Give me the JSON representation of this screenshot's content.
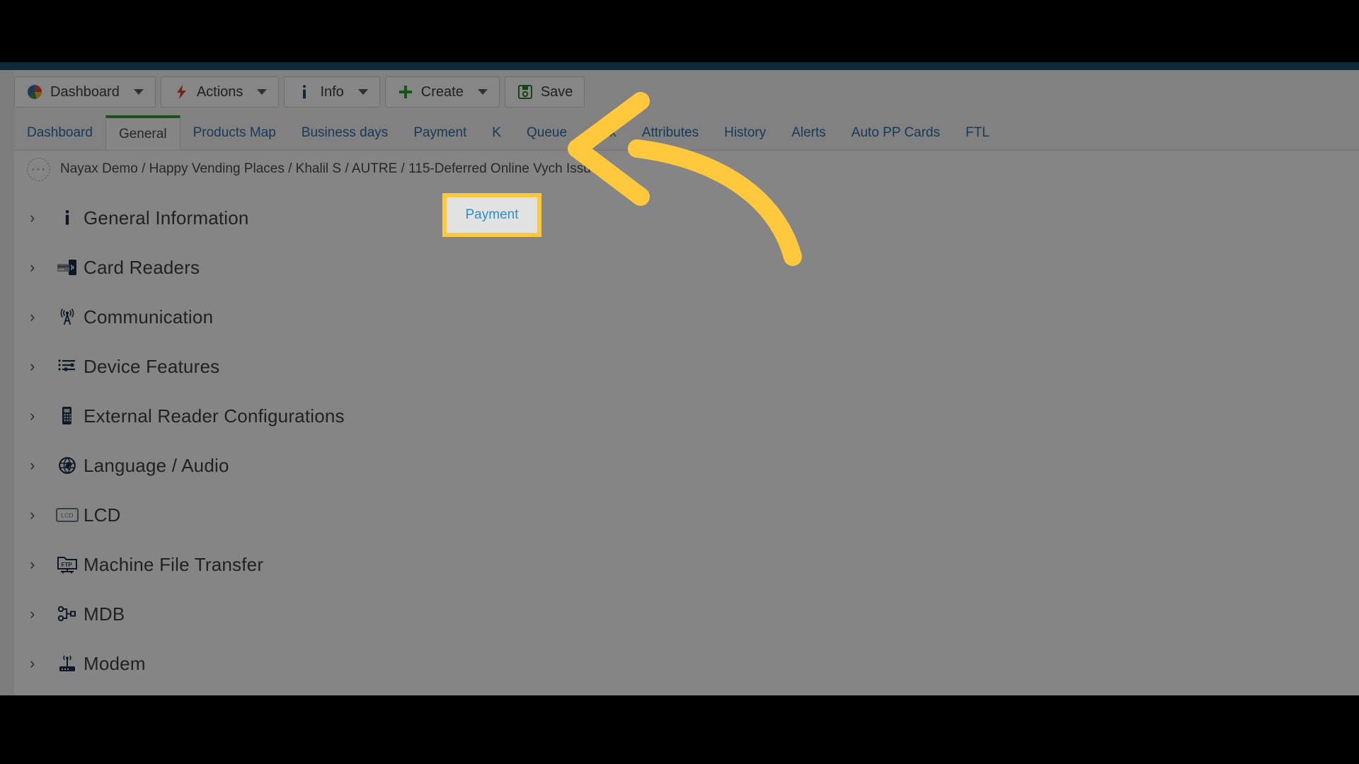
{
  "app": {
    "strip_color": "#1f4e6b",
    "page_bg": "#fbfbfb"
  },
  "toolbar": {
    "buttons": [
      {
        "label": "Dashboard",
        "icon": "pie-chart-icon",
        "has_caret": true
      },
      {
        "label": "Actions",
        "icon": "lightning-bolt-icon",
        "has_caret": true
      },
      {
        "label": "Info",
        "icon": "info-icon",
        "has_caret": true
      },
      {
        "label": "Create",
        "icon": "plus-icon",
        "has_caret": true
      },
      {
        "label": "Save",
        "icon": "floppy-disk-icon",
        "has_caret": false
      }
    ]
  },
  "tabs": {
    "items": [
      {
        "label": "Dashboard",
        "active": false
      },
      {
        "label": "General",
        "active": true
      },
      {
        "label": "Products Map",
        "active": false
      },
      {
        "label": "Business days",
        "active": false
      },
      {
        "label": "Payment",
        "active": false,
        "highlighted": true
      },
      {
        "label": "K",
        "active": false
      },
      {
        "label": "Queue",
        "active": false
      },
      {
        "label": "Dex",
        "active": false
      },
      {
        "label": "Attributes",
        "active": false
      },
      {
        "label": "History",
        "active": false
      },
      {
        "label": "Alerts",
        "active": false
      },
      {
        "label": "Auto PP Cards",
        "active": false
      },
      {
        "label": "FTL",
        "active": false
      }
    ]
  },
  "breadcrumb": {
    "dots": "···",
    "path": "Nayax Demo / Happy Vending Places / Khalil S / AUTRE / 115-Deferred Online Vych Issue"
  },
  "sections": {
    "items": [
      {
        "label": "General Information",
        "icon": "info-icon"
      },
      {
        "label": "Card Readers",
        "icon": "card-reader-icon"
      },
      {
        "label": "Communication",
        "icon": "antenna-icon"
      },
      {
        "label": "Device Features",
        "icon": "sliders-icon"
      },
      {
        "label": "External Reader Configurations",
        "icon": "reader-device-icon"
      },
      {
        "label": "Language / Audio",
        "icon": "globe-icon"
      },
      {
        "label": "LCD",
        "icon": "lcd-screen-icon"
      },
      {
        "label": "Machine File Transfer",
        "icon": "ftp-folder-icon"
      },
      {
        "label": "MDB",
        "icon": "mdb-network-icon"
      },
      {
        "label": "Modem",
        "icon": "modem-icon"
      }
    ],
    "chevron": "›"
  },
  "callout": {
    "target_tab": "Payment",
    "highlight_color": "#ffc83d",
    "arrow_color": "#ffc83d"
  },
  "colors": {
    "accent_blue": "#2e6ca4",
    "active_tab_underline": "#2f9e2f",
    "highlight_yellow": "#ffc83d",
    "dim_overlay": "rgba(0,0,0,0.47)"
  }
}
